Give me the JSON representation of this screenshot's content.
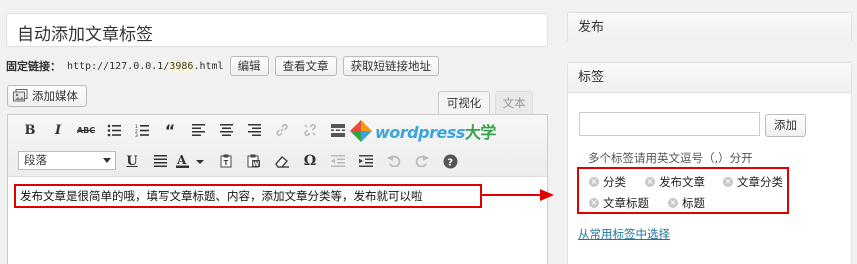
{
  "post_title": "自动添加文章标签",
  "permalink": {
    "label": "固定链接：",
    "url_prefix": "http://127.0.0.1/",
    "url_slug": "3986",
    "url_suffix": ".html",
    "edit_label": "编辑",
    "view_label": "查看文章",
    "shortlink_label": "获取短链接地址"
  },
  "add_media_label": "添加媒体",
  "editor_tabs": {
    "visual": "可视化",
    "text": "文本"
  },
  "format_select": "段落",
  "logo": {
    "text_en": "wordpress",
    "text_cn": "大学"
  },
  "content_text": "发布文章是很简单的哦，填写文章标题、内容，添加文章分类等，发布就可以啦",
  "publish_box": {
    "title": "发布"
  },
  "tags_box": {
    "title": "标签",
    "add_label": "添加",
    "help_text": "多个标签请用英文逗号（,）分开",
    "tags": [
      "分类",
      "发布文章",
      "文章分类",
      "文章标题",
      "标题"
    ],
    "cloud_link": "从常用标签中选择"
  },
  "colors": {
    "highlight_red": "#e10000",
    "link_blue": "#21759b"
  }
}
